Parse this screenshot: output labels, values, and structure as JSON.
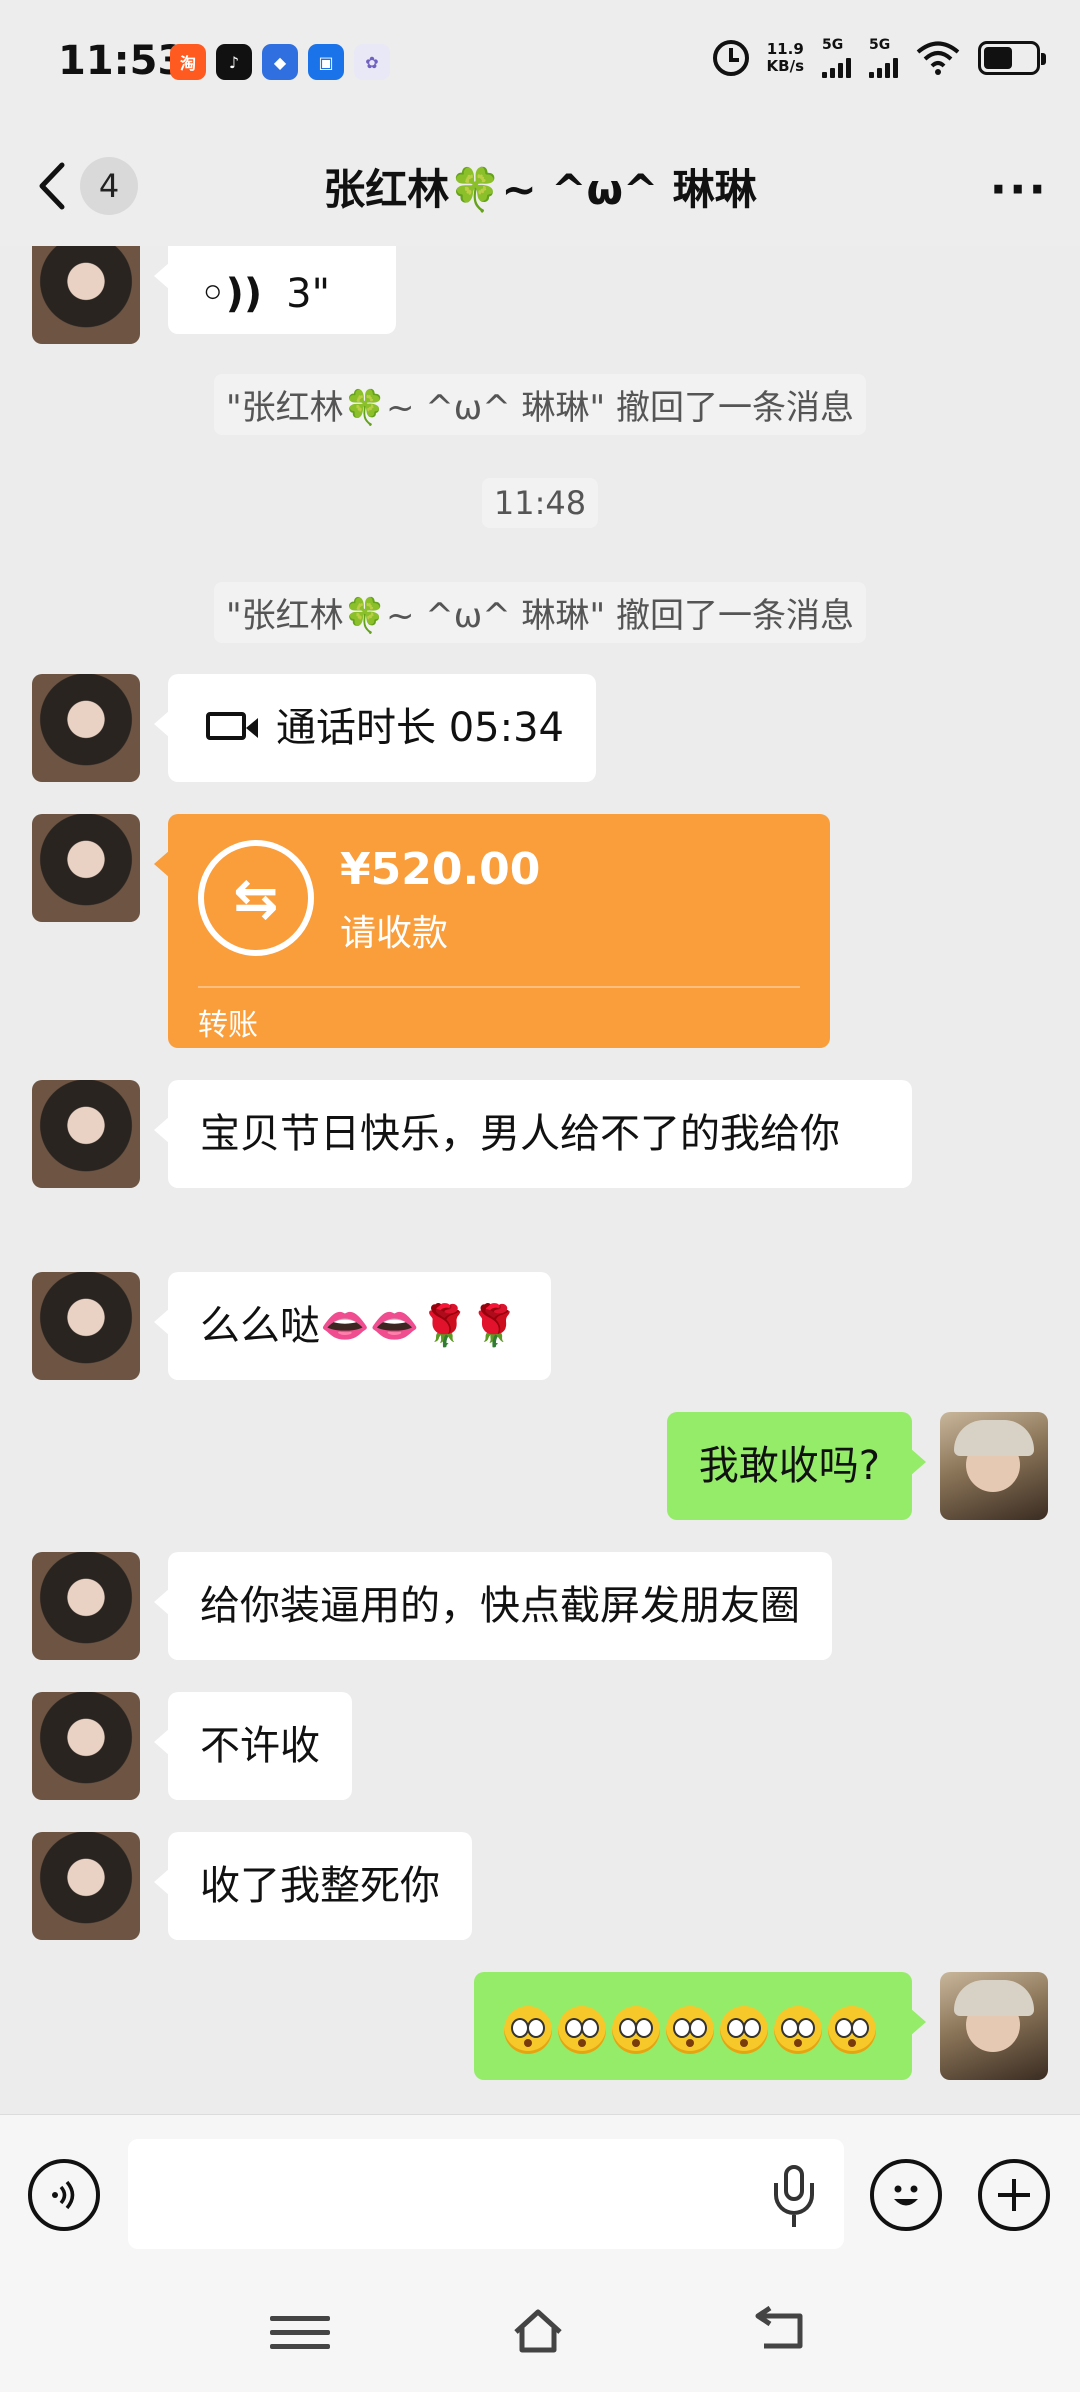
{
  "status_bar": {
    "time": "11:53",
    "net_speed_value": "11.9",
    "net_speed_unit": "KB/s",
    "sim1": "5G",
    "sim2": "5G",
    "app_icons": [
      "taobao-tejia-icon",
      "douyin-icon",
      "blue-app-icon",
      "outlook-icon",
      "photo-app-icon"
    ]
  },
  "header": {
    "back_label": "<",
    "unread_count": "4",
    "title": "张红林🍀~  ^ω^  琳琳",
    "more_label": "···"
  },
  "messages": {
    "voice": {
      "duration": "3\"",
      "icon_glyph": "◦))"
    },
    "recall_1": "\"张红林🍀~  ^ω^  琳琳\" 撤回了一条消息",
    "timestamp": "11:48",
    "recall_2": "\"张红林🍀~  ^ω^  琳琳\" 撤回了一条消息",
    "video_call": "通话时长 05:34",
    "transfer": {
      "amount": "¥520.00",
      "status": "请收款",
      "label": "转账",
      "icon_glyph": "⇆",
      "color": "#fa9d3b"
    },
    "msg_holiday": "宝贝节日快乐，男人给不了的我给你",
    "msg_kiss_text": "么么哒",
    "msg_kiss_emoji": "👄👄🌹🌹",
    "msg_dare": "我敢收吗?",
    "msg_showoff": "给你装逼用的，快点截屏发朋友圈",
    "msg_not_allowed": "不许收",
    "msg_threat": "收了我整死你",
    "emoji_reply_count": 7
  },
  "input_bar": {
    "placeholder": "",
    "voice_button": "◉",
    "emoji_button": "☺",
    "plus_button": "+"
  },
  "colors": {
    "background": "#ededed",
    "outgoing_bubble": "#95ec69",
    "incoming_bubble": "#ffffff"
  }
}
